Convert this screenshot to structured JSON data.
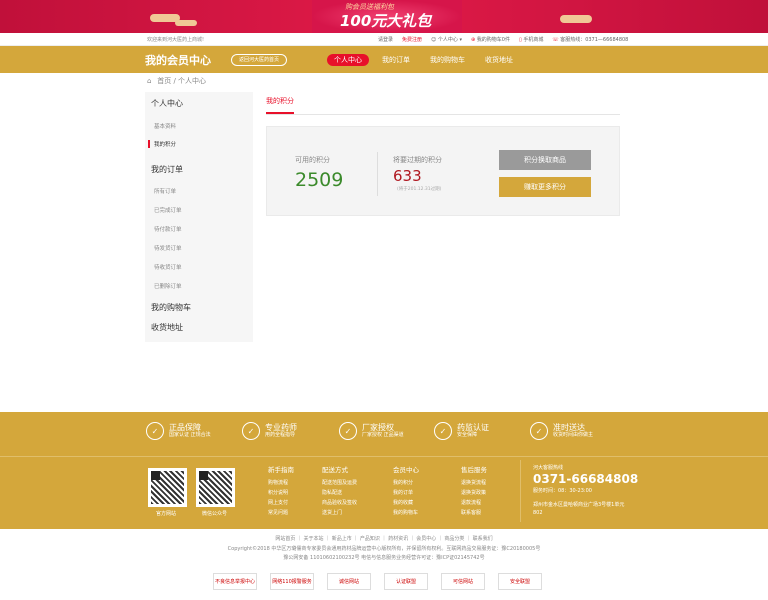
{
  "banner": {
    "line1": "购会员送福利包",
    "line2": "100元大礼包"
  },
  "topbar": {
    "welcome": "欢迎来到河大医药上商城!",
    "login": "请登录",
    "register": "免费注册",
    "member_center": "个人中心",
    "cart": "我的购物车0件",
    "mobile": "手机商城",
    "hotline": "客服热线：0371—66684808"
  },
  "header": {
    "title": "我的会员中心",
    "home_button": "返回河大医药首页",
    "nav": [
      "个人中心",
      "我的订单",
      "我的购物车",
      "收货地址"
    ],
    "active_index": 0
  },
  "breadcrumb": "首页 / 个人中心",
  "sidebar": {
    "groups": [
      {
        "title": "个人中心",
        "items": [
          "基本资料",
          "我的积分"
        ]
      },
      {
        "title": "我的订单",
        "items": [
          "所有订单",
          "已完成订单",
          "待付款订单",
          "待发货订单",
          "待收货订单",
          "已删除订单"
        ]
      },
      {
        "title": "我的购物车",
        "items": []
      },
      {
        "title": "收货地址",
        "items": []
      }
    ],
    "active_item": "我的积分"
  },
  "main": {
    "section_title": "我的积分",
    "available_label": "可用的积分",
    "available_value": "2509",
    "expiring_label": "将要过期的积分",
    "expiring_value": "633",
    "expiring_note": "(将于201.12.31过期)",
    "exchange_button": "积分换取商品",
    "earn_button": "赚取更多积分"
  },
  "footer": {
    "guarantees": [
      {
        "title": "正品保障",
        "sub": "国家认证 正规合法"
      },
      {
        "title": "专业药师",
        "sub": "用药全程指导"
      },
      {
        "title": "厂家授权",
        "sub": "厂家授权 正品渠道"
      },
      {
        "title": "药监认证",
        "sub": "安全保障"
      },
      {
        "title": "准时送达",
        "sub": "收货时间由你做主"
      }
    ],
    "qr": [
      {
        "label": "官方网站"
      },
      {
        "label": "微信公众号"
      }
    ],
    "columns": [
      {
        "title": "新手指南",
        "items": [
          "购物流程",
          "积分说明",
          "网上支付",
          "常见问题"
        ]
      },
      {
        "title": "配送方式",
        "items": [
          "配送范围及运费",
          "隐私配送",
          "商品验收及签收",
          "送货上门"
        ]
      },
      {
        "title": "会员中心",
        "items": [
          "我的积分",
          "我的订单",
          "我的收藏",
          "我的购物车"
        ]
      },
      {
        "title": "售后服务",
        "items": [
          "退换货流程",
          "退换货政策",
          "退款流程",
          "联系客服"
        ]
      }
    ],
    "hotline_label": "河大客服热线",
    "phone": "0371-66684808",
    "hours": "服务时间：08：30-23:00",
    "address": "郑州市金水区曼哈顿商业广场3号楼1单元802"
  },
  "bottom": {
    "links": "网站首页 ｜ 关于本站 ｜ 新品上市 ｜ 产品知识 ｜ 药材资讯 ｜ 会员中心 ｜ 商品分类 ｜ 联系我们",
    "copyright": "Copyright©2018 中华区万璐儒商专家委员会通用药材品牌运营中心版权所有，并保留所有权利。互联网药品交易服务证：豫C20180005号",
    "icp": "豫公网安备 11010602100232号  电信与信息服务业务经营许可证：豫ICP证02145742号",
    "certs": [
      "不良信息举报中心",
      "网络110报警服务",
      "诚信网站",
      "认证联盟",
      "可信网站",
      "安全联盟"
    ]
  }
}
